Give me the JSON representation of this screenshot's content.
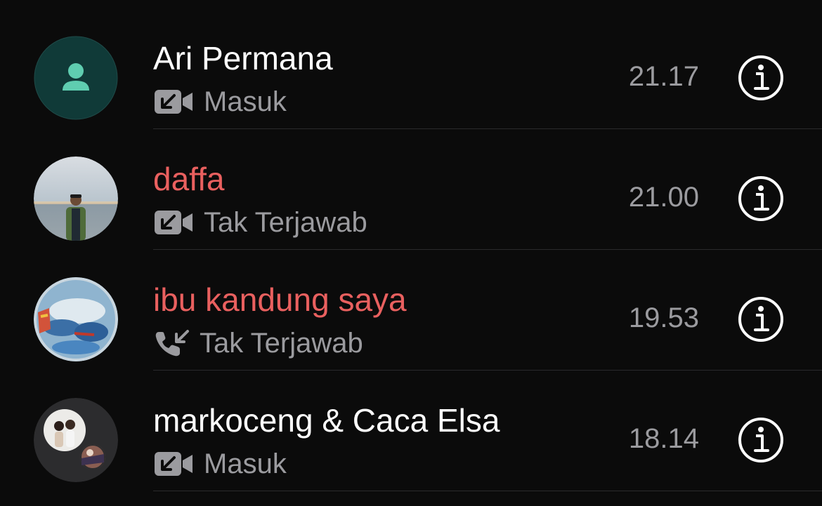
{
  "calls": [
    {
      "name": "Ari Permana",
      "status": "Masuk",
      "time": "21.17",
      "missed": false,
      "call_type": "video",
      "direction": "incoming",
      "avatar": "person-placeholder-icon"
    },
    {
      "name": "daffa",
      "status": "Tak Terjawab",
      "time": "21.00",
      "missed": true,
      "call_type": "video",
      "direction": "incoming",
      "avatar": "photo"
    },
    {
      "name": "ibu kandung saya",
      "status": "Tak Terjawab",
      "time": "19.53",
      "missed": true,
      "call_type": "voice",
      "direction": "incoming",
      "avatar": "photo"
    },
    {
      "name": "markoceng & Caca Elsa",
      "status": "Masuk",
      "time": "18.14",
      "missed": false,
      "call_type": "video",
      "direction": "incoming",
      "avatar": "group-photo"
    }
  ],
  "colors": {
    "background": "#0b0b0b",
    "missed": "#e9605f",
    "secondary_text": "#9b9b9f",
    "primary_text": "#ffffff",
    "placeholder_avatar_bg": "#103a38",
    "placeholder_avatar_fg": "#5fcdb0"
  },
  "icons": {
    "info": "info-circle-icon",
    "video_incoming": "incoming-video-call-icon",
    "voice_incoming": "incoming-voice-call-icon"
  }
}
